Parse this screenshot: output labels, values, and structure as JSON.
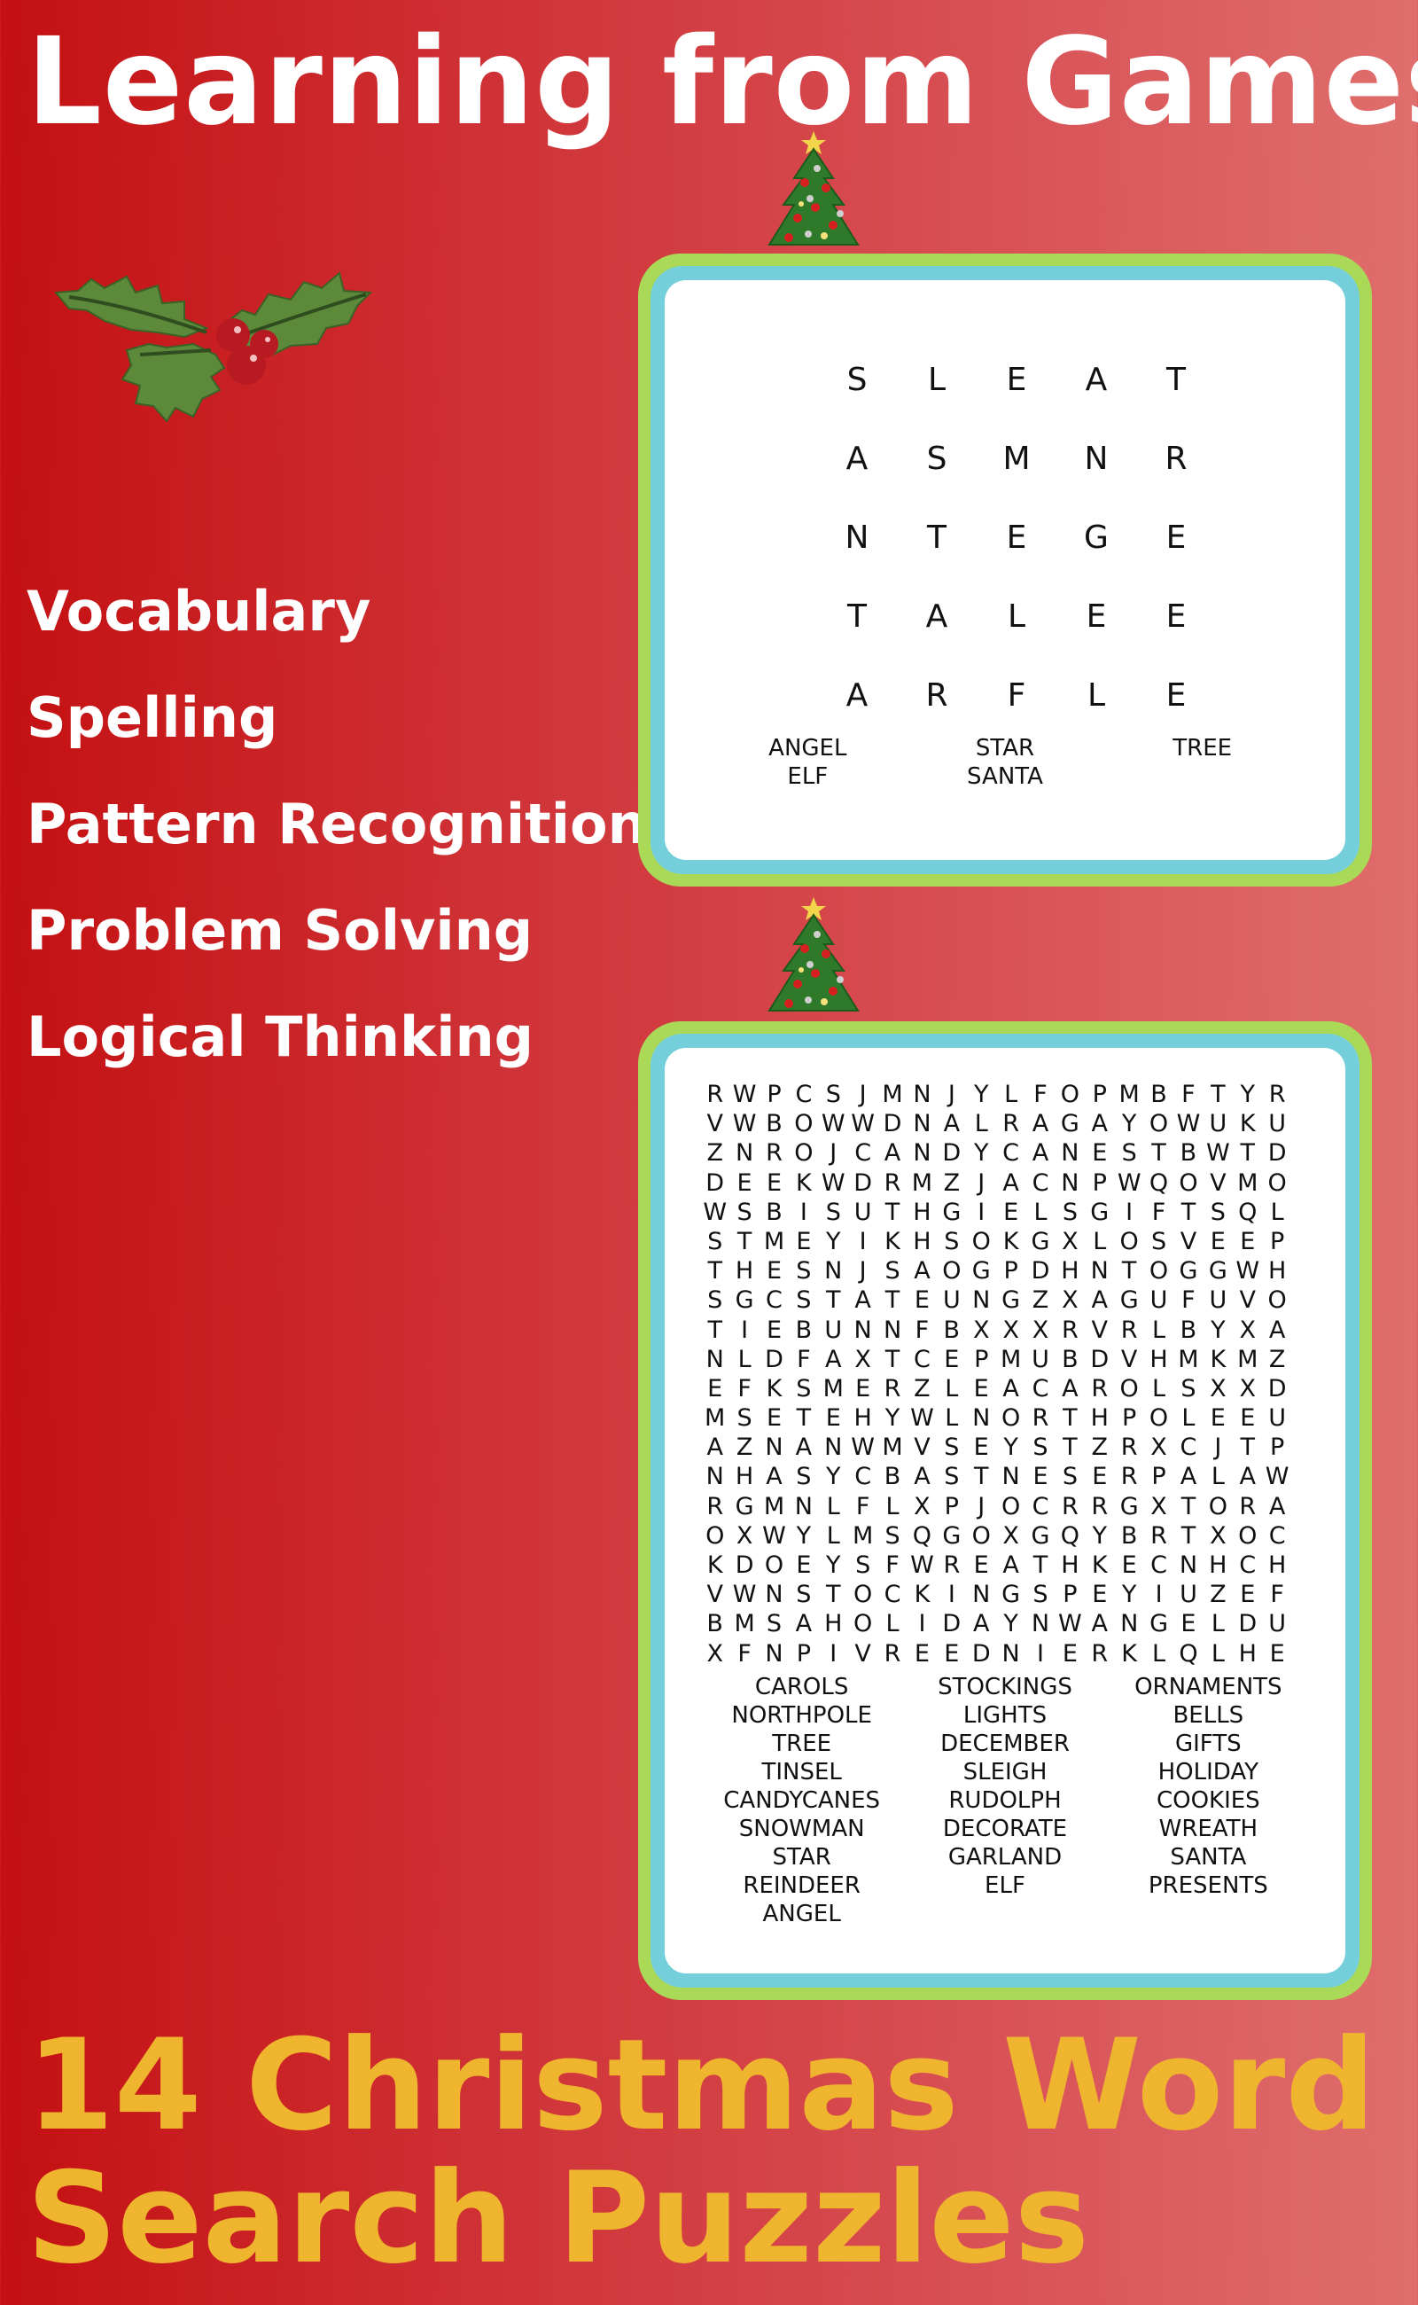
{
  "header": {
    "title": "Learning from Games"
  },
  "skills": [
    "Vocabulary",
    "Spelling",
    "Pattern Recognition",
    "Problem Solving",
    "Logical Thinking"
  ],
  "colors": {
    "background_left": "#c41012",
    "background_right": "#df6e6c",
    "frame_outer": "#a9d957",
    "frame_inner": "#74cfdb",
    "title_text": "#ffffff",
    "footer_text": "#efb52e"
  },
  "icons": {
    "decoration_top_left": "holly-icon",
    "puzzle_topper": "christmas-tree-icon"
  },
  "puzzle_small": {
    "grid": [
      [
        "S",
        "L",
        "E",
        "A",
        "T"
      ],
      [
        "A",
        "S",
        "M",
        "N",
        "R"
      ],
      [
        "N",
        "T",
        "E",
        "G",
        "E"
      ],
      [
        "T",
        "A",
        "L",
        "E",
        "E"
      ],
      [
        "A",
        "R",
        "F",
        "L",
        "E"
      ]
    ],
    "word_columns": [
      [
        "ANGEL",
        "ELF"
      ],
      [
        "STAR",
        "SANTA"
      ],
      [
        "TREE"
      ]
    ]
  },
  "puzzle_large": {
    "grid": [
      "RWPCSJMNJYLFOPMBFTYR",
      "VWBOWWDNALRAGAYOWUKU",
      "ZNROJCANDYCANESTBWTD",
      "DEEKWDRMZJACNPWQOVMO",
      "WSBISUTHGIELSGIFTSQL",
      "STMEYIKHSOKGXLOSVEEP",
      "THESNJSAOGPDHNTOGGWH",
      "SGCSTATEUNGZXAGUFUVO",
      "TIEBUNNFBXXXRVRLBYXA",
      "NLDFAXTCEPMUBDVHMKMZ",
      "EFKSMERZLEACAROLSXXD",
      "MSETEHYWLNORTHPOLEEU",
      "AZNANWMVSEYSTZRXCJTP",
      "NHASYCBASTNESERPALAW",
      "RGMNLFLXPJOCRRGXTORA",
      "OXWYLMSQGOXGQYBRTXOC",
      "KDOEYSFWREATHKECNHCH",
      "VWNSTOCKINGSPEYIUZEF",
      "BMSAHOLIDAYNWANGELDU",
      "XFNPIVREEDNIERKLQLHE"
    ],
    "word_columns": [
      [
        "CAROLS",
        "NORTHPOLE",
        "TREE",
        "TINSEL",
        "CANDYCANES",
        "SNOWMAN",
        "STAR",
        "REINDEER",
        "ANGEL"
      ],
      [
        "STOCKINGS",
        "LIGHTS",
        "DECEMBER",
        "SLEIGH",
        "RUDOLPH",
        "DECORATE",
        "GARLAND",
        "ELF"
      ],
      [
        "ORNAMENTS",
        "BELLS",
        "GIFTS",
        "HOLIDAY",
        "COOKIES",
        "WREATH",
        "SANTA",
        "PRESENTS"
      ]
    ]
  },
  "footer": {
    "line1": "14 Christmas Word",
    "line2": "Search Puzzles"
  }
}
